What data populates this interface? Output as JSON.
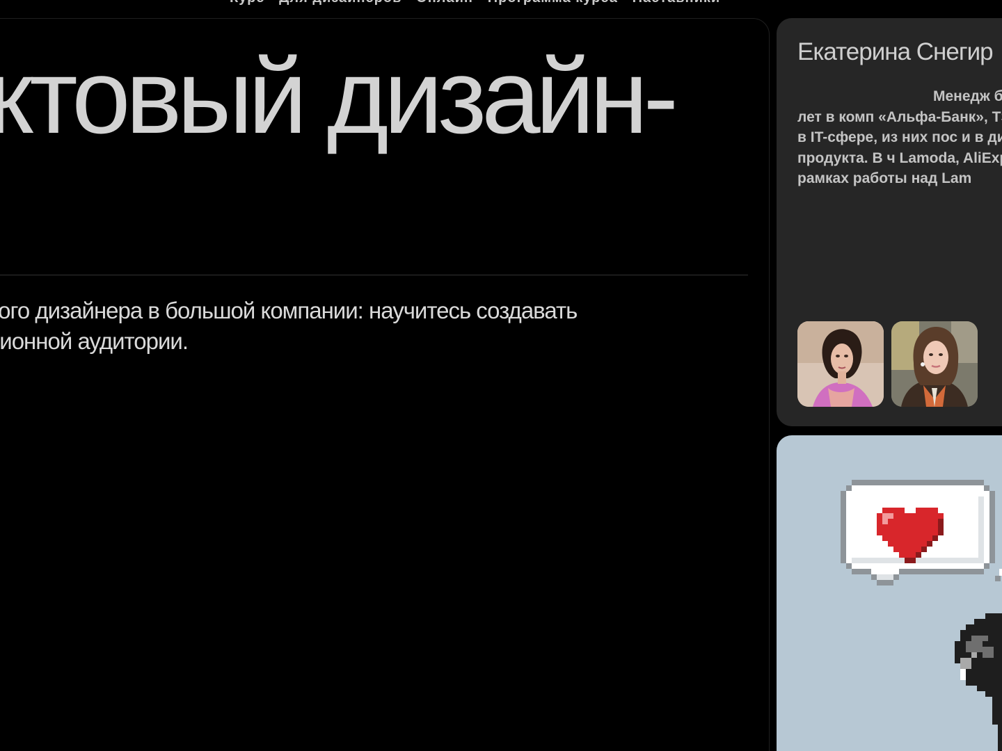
{
  "top_strip_text": "Курс · Для дизайнеров · Онлайн · Программа курса · Наставники",
  "course": {
    "title": "ктовый дизайн-",
    "description": "вого дизайнера в большой компании: научитесь создавать\nлионной аудитории."
  },
  "author": {
    "name": "Екатерина Снегир",
    "bio": "Менедж более восьми лет в комп «Альфа-Банк», TSUM.ru и лет в IT-сфере, из них пос и в дизайне продукта. В ч Lamoda, AliExpress, сотру в рамках работы над Lam",
    "avatars": [
      {
        "icon": "person-photo-1"
      },
      {
        "icon": "person-photo-2"
      }
    ]
  },
  "illustration": {
    "icon": "pixel-heart-speech-bubble",
    "background": "#b7c8d4",
    "heart_color": "#d8262b"
  },
  "colors": {
    "page_bg": "#000000",
    "card_bg": "#262626",
    "text": "#d3d3d3"
  }
}
